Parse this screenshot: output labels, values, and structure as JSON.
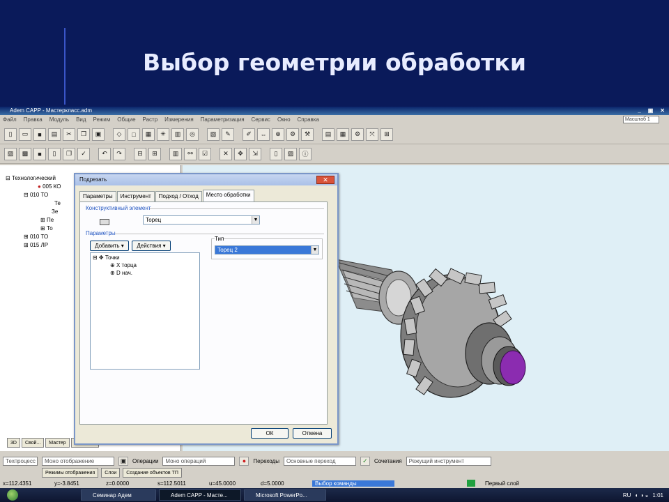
{
  "slide": {
    "title": "Выбор геометрии обработки"
  },
  "window": {
    "title": "Adem CAPP - Мастеркласс.adm",
    "buttons": [
      "_",
      "▣",
      "✕"
    ],
    "scale_label": "Масштаб 1"
  },
  "menu": [
    "Файл",
    "Правка",
    "Модуль",
    "Вид",
    "Режим",
    "Общие",
    "Растр",
    "Измерения",
    "Параметризация",
    "Сервис",
    "Окно",
    "Справка"
  ],
  "tree": {
    "items": [
      {
        "prefix": "⊟",
        "label": "Технологический"
      },
      {
        "prefix": "●",
        "label": "005 КО"
      },
      {
        "prefix": "⊟",
        "label": "010 ТО"
      },
      {
        "prefix": "",
        "label": "Те"
      },
      {
        "prefix": "",
        "label": "Зе"
      },
      {
        "prefix": "⊞",
        "label": "Пе"
      },
      {
        "prefix": "⊞",
        "label": "То"
      },
      {
        "prefix": "⊞",
        "label": "010 ТО"
      },
      {
        "prefix": "⊞",
        "label": "015 ЛР"
      }
    ]
  },
  "dialog": {
    "title": "Подрезать",
    "close_label": "✕",
    "tabs": [
      "Параметры",
      "Инструмент",
      "Подход / Отход",
      "Место обработки"
    ],
    "group_element": "Конструктивный элемент",
    "element_value": "Торец",
    "group_params": "Параметры",
    "add_button": "Добавить",
    "actions_button": "Действия",
    "list": {
      "root": "Точки",
      "items": [
        "Х торца",
        "D нач."
      ]
    },
    "type_label": "Тип",
    "type_value": "Торец 2",
    "ok": "ОК",
    "cancel": "Отмена"
  },
  "bottom_tabs": [
    "3D",
    "Свой...",
    "Мастер",
    ""
  ],
  "status": {
    "row1": {
      "field1": "Техпроцесс",
      "field2": "Моно отображение",
      "ops_label": "Операции",
      "ops_value": "Моно операций",
      "transitions_label": "Переходы",
      "transitions_value": "Основные переход",
      "combo_label": "Сочетания",
      "combo_value": "Режущий инструмент"
    },
    "row2_tabs": [
      "Режимы отображения",
      "Слои",
      "Создание объектов ТП"
    ],
    "coords": [
      "x=112.4351",
      "y=-3.8451",
      "z=0.0000",
      "s=112.5011",
      "u=45.0000",
      "d=5.0000"
    ],
    "command": "Выбор команды",
    "layer": "Первый слой"
  },
  "taskbar": {
    "tasks": [
      "Семинар Адем",
      "Adem CAPP - Масте...",
      "Microsoft PowerPo..."
    ],
    "lang": "RU",
    "time": "1:01"
  },
  "colors": {
    "slide_bg": "#0a1a5a",
    "viewport_bg": "#dfeff6",
    "gear": "#9a9a9a",
    "face": "#8b2cb0"
  }
}
